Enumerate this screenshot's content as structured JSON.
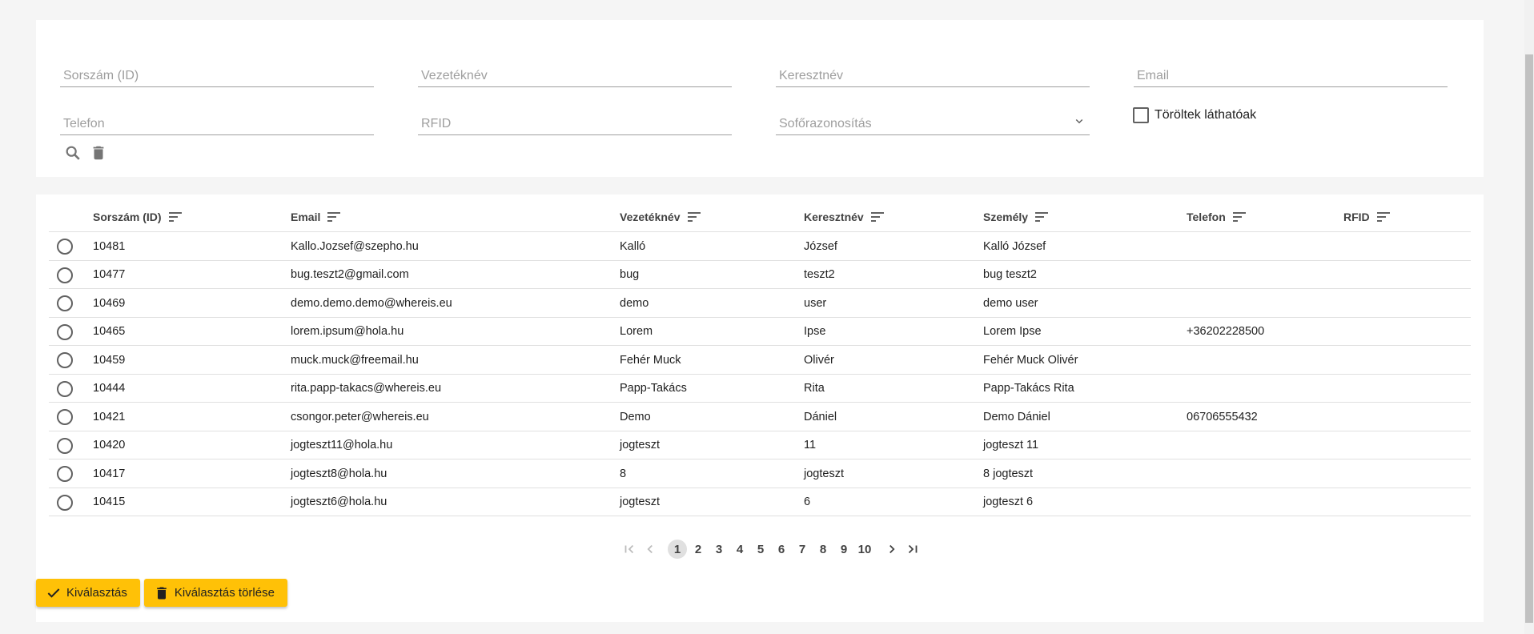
{
  "filters": {
    "id_placeholder": "Sorszám (ID)",
    "lastname_placeholder": "Vezetéknév",
    "firstname_placeholder": "Keresztnév",
    "email_placeholder": "Email",
    "phone_placeholder": "Telefon",
    "rfid_placeholder": "RFID",
    "driver_id_label": "Sofőrazonosítás",
    "show_deleted_label": "Töröltek láthatóak",
    "search_icon": "search-icon",
    "delete_icon": "trash-icon"
  },
  "table": {
    "columns": [
      "Sorszám (ID)",
      "Email",
      "Vezetéknév",
      "Keresztnév",
      "Személy",
      "Telefon",
      "RFID"
    ],
    "rows": [
      {
        "id": "10481",
        "email": "Kallo.Jozsef@szepho.hu",
        "last": "Kalló",
        "first": "József",
        "person": "Kalló József",
        "phone": "",
        "rfid": ""
      },
      {
        "id": "10477",
        "email": "bug.teszt2@gmail.com",
        "last": "bug",
        "first": "teszt2",
        "person": "bug teszt2",
        "phone": "",
        "rfid": ""
      },
      {
        "id": "10469",
        "email": "demo.demo.demo@whereis.eu",
        "last": "demo",
        "first": "user",
        "person": "demo user",
        "phone": "",
        "rfid": ""
      },
      {
        "id": "10465",
        "email": "lorem.ipsum@hola.hu",
        "last": "Lorem",
        "first": "Ipse",
        "person": "Lorem Ipse",
        "phone": "+36202228500",
        "rfid": ""
      },
      {
        "id": "10459",
        "email": "muck.muck@freemail.hu",
        "last": "Fehér Muck",
        "first": "Olivér",
        "person": "Fehér Muck Olivér",
        "phone": "",
        "rfid": ""
      },
      {
        "id": "10444",
        "email": "rita.papp-takacs@whereis.eu",
        "last": "Papp-Takács",
        "first": "Rita",
        "person": "Papp-Takács Rita",
        "phone": "",
        "rfid": ""
      },
      {
        "id": "10421",
        "email": "csongor.peter@whereis.eu",
        "last": "Demo",
        "first": "Dániel",
        "person": "Demo Dániel",
        "phone": "06706555432",
        "rfid": ""
      },
      {
        "id": "10420",
        "email": "jogteszt11@hola.hu",
        "last": "jogteszt",
        "first": "11",
        "person": "jogteszt 11",
        "phone": "",
        "rfid": ""
      },
      {
        "id": "10417",
        "email": "jogteszt8@hola.hu",
        "last": "8",
        "first": "jogteszt",
        "person": "8 jogteszt",
        "phone": "",
        "rfid": ""
      },
      {
        "id": "10415",
        "email": "jogteszt6@hola.hu",
        "last": "jogteszt",
        "first": "6",
        "person": "jogteszt 6",
        "phone": "",
        "rfid": ""
      }
    ]
  },
  "pagination": {
    "pages": [
      "1",
      "2",
      "3",
      "4",
      "5",
      "6",
      "7",
      "8",
      "9",
      "10"
    ],
    "current": "1"
  },
  "actions": {
    "select_label": "Kiválasztás",
    "clear_selection_label": "Kiválasztás törlése"
  },
  "colors": {
    "accent": "#ffc107",
    "background": "#f5f5f5"
  }
}
